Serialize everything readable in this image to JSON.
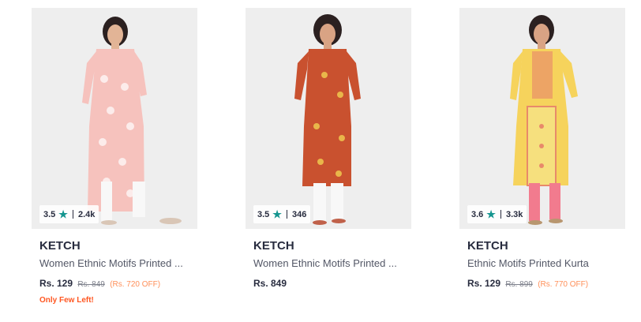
{
  "products": [
    {
      "rating": "3.5",
      "reviews": "2.4k",
      "brand": "KETCH",
      "title": "Women Ethnic Motifs Printed ...",
      "price": "Rs. 129",
      "mrp": "Rs. 849",
      "discount": "(Rs. 720 OFF)",
      "stock_note": "Only Few Left!",
      "kurta_color": "#f6c2bd",
      "print_color": "#ffffff"
    },
    {
      "rating": "3.5",
      "reviews": "346",
      "brand": "KETCH",
      "title": "Women Ethnic Motifs Printed ...",
      "price": "Rs. 849",
      "kurta_color": "#c9512f",
      "print_color": "#e9b64a"
    },
    {
      "rating": "3.6",
      "reviews": "3.3k",
      "brand": "KETCH",
      "title": "Ethnic Motifs Printed Kurta",
      "price": "Rs. 129",
      "mrp": "Rs. 899",
      "discount": "(Rs. 770 OFF)",
      "kurta_color": "#f6d35c",
      "print_color": "#e88a6a"
    }
  ],
  "colors": {
    "rating_star": "#14958f",
    "discount": "#ff905a",
    "stock_warning": "#ff5722"
  },
  "icons": {
    "rating": "star-icon"
  }
}
